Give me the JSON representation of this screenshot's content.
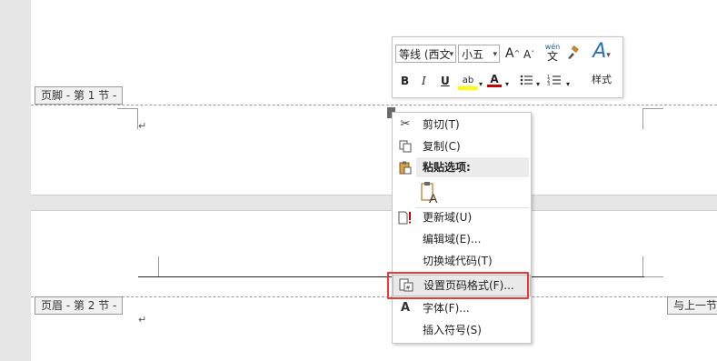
{
  "page1": {
    "footer_tag": "页脚 - 第 1 节 -"
  },
  "page2": {
    "header_tag": "页眉 - 第 2 节 -",
    "link_tag": "与上一节"
  },
  "paragraph_mark": "↵",
  "mini_toolbar": {
    "font_name": "等线 (西文",
    "font_size": "小五",
    "grow_font": "A",
    "shrink_font": "A",
    "phonetic": "wén",
    "format_painter_icon": "brush-icon",
    "styles_label": "样式",
    "bold": "B",
    "italic": "I",
    "underline": "U",
    "highlight": "ab",
    "font_color": "A",
    "highlight_color": "#ffff00",
    "font_color_bar": "#c00000",
    "bullets_icon": "bullets-icon",
    "numbering_icon": "numbering-icon"
  },
  "context_menu": {
    "items": [
      {
        "label": "剪切(T)",
        "icon": "scissors-icon"
      },
      {
        "label": "复制(C)",
        "icon": "copy-icon"
      },
      {
        "label": "粘贴选项:",
        "icon": "paste-icon"
      },
      {
        "label": "更新域(U)",
        "icon": "update-field-icon"
      },
      {
        "label": "编辑域(E)...",
        "icon": ""
      },
      {
        "label": "切换域代码(T)",
        "icon": ""
      },
      {
        "label": "设置页码格式(F)...",
        "icon": "page-number-format-icon"
      },
      {
        "label": "字体(F)...",
        "icon": "font-icon"
      },
      {
        "label": "插入符号(S)",
        "icon": ""
      }
    ],
    "paste_option_glyph": "A",
    "highlight_color": "#e8393b"
  }
}
